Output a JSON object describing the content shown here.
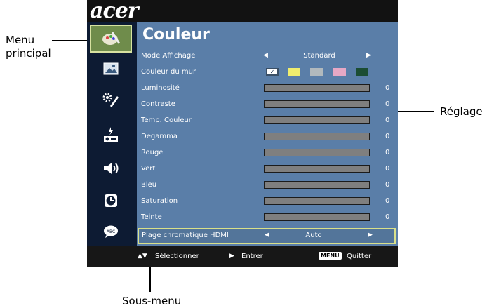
{
  "brand": "acer",
  "panel": {
    "title": "Couleur",
    "rows": [
      {
        "label": "Mode Affichage",
        "type": "option",
        "value": "Standard"
      },
      {
        "label": "Couleur du mur",
        "type": "swatches",
        "swatches": [
          "#ffffff",
          "#f0ed6e",
          "#b1b9bd",
          "#e7a8c5",
          "#1b4d33"
        ]
      },
      {
        "label": "Luminosité",
        "type": "slider",
        "value": "0"
      },
      {
        "label": "Contraste",
        "type": "slider",
        "value": "0"
      },
      {
        "label": "Temp. Couleur",
        "type": "slider",
        "value": "0"
      },
      {
        "label": "Degamma",
        "type": "slider",
        "value": "0"
      },
      {
        "label": "Rouge",
        "type": "slider",
        "value": "0"
      },
      {
        "label": "Vert",
        "type": "slider",
        "value": "0"
      },
      {
        "label": "Bleu",
        "type": "slider",
        "value": "0"
      },
      {
        "label": "Saturation",
        "type": "slider",
        "value": "0"
      },
      {
        "label": "Teinte",
        "type": "slider",
        "value": "0"
      },
      {
        "label": "Plage chromatique HDMI",
        "type": "option",
        "value": "Auto",
        "selected": true
      }
    ]
  },
  "sidebar": {
    "items": [
      {
        "icon": "color-palette-icon",
        "active": true
      },
      {
        "icon": "image-icon"
      },
      {
        "icon": "settings-tools-icon"
      },
      {
        "icon": "projector-icon"
      },
      {
        "icon": "speaker-icon"
      },
      {
        "icon": "clock-icon"
      },
      {
        "icon": "language-icon"
      }
    ]
  },
  "bottom_bar": {
    "select": "Sélectionner",
    "enter": "Entrer",
    "menu_key": "MENU",
    "quit": "Quitter"
  },
  "callouts": {
    "main_menu_line1": "Menu",
    "main_menu_line2": "principal",
    "setting": "Réglage",
    "submenu": "Sous-menu"
  },
  "colors": {
    "panel_bg": "#5a7ea8",
    "sidebar_bg": "#0d1b33",
    "bar_fill": "#7f7f7f",
    "highlight_border": "#d9e08a"
  }
}
